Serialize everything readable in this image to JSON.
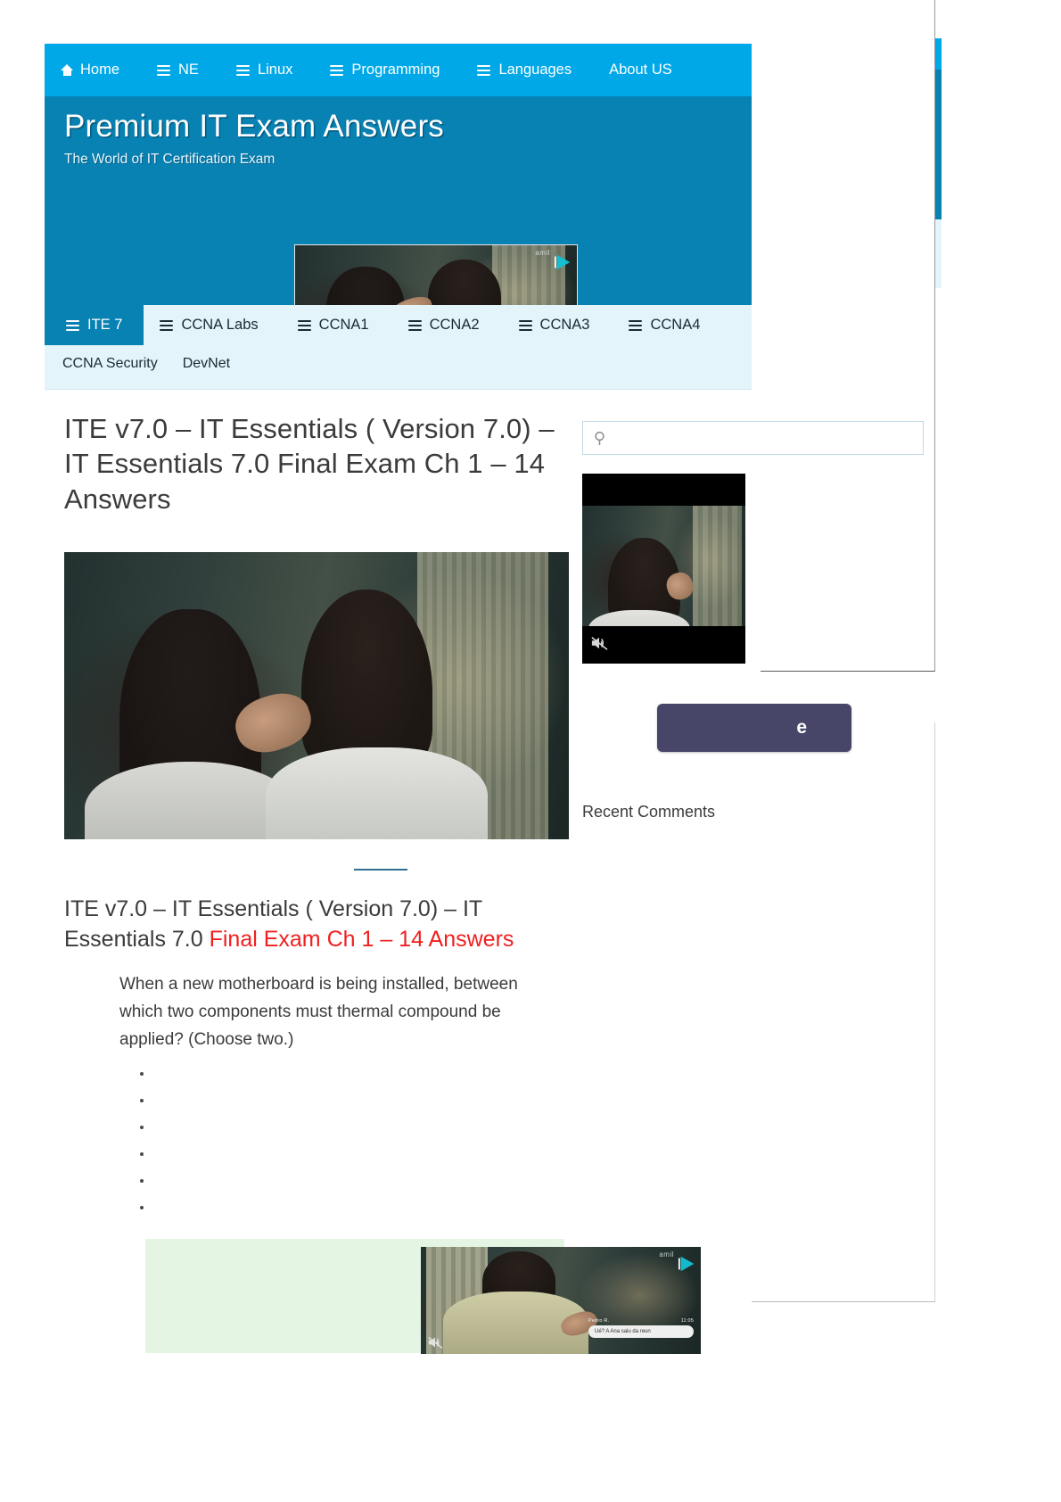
{
  "topnav": {
    "items": [
      {
        "label": "Home",
        "icon": "home-icon",
        "has_menu": false
      },
      {
        "label": "NE",
        "icon": "hamburger-icon",
        "has_menu": true
      },
      {
        "label": "Linux",
        "icon": "hamburger-icon",
        "has_menu": true
      },
      {
        "label": "Programming",
        "icon": "hamburger-icon",
        "has_menu": true
      },
      {
        "label": "Languages",
        "icon": "hamburger-icon",
        "has_menu": true
      },
      {
        "label": "About US",
        "icon": "",
        "has_menu": false
      }
    ]
  },
  "hero": {
    "title": "Premium IT Exam Answers",
    "tagline": "The World of IT Certification Exam",
    "ad_video": {
      "brand_watermark": "amil",
      "muted": true,
      "play_icon": "play-triangle-icon"
    }
  },
  "subnav": {
    "row1": [
      {
        "label": "ITE 7",
        "icon": "hamburger-icon",
        "active": true
      },
      {
        "label": "CCNA Labs",
        "icon": "hamburger-icon",
        "active": false
      },
      {
        "label": "CCNA1",
        "icon": "hamburger-icon",
        "active": false
      },
      {
        "label": "CCNA2",
        "icon": "hamburger-icon",
        "active": false
      },
      {
        "label": "CCNA3",
        "icon": "hamburger-icon",
        "active": false
      },
      {
        "label": "CCNA4",
        "icon": "hamburger-icon",
        "active": false
      }
    ],
    "row2": [
      {
        "label": "CCNA Security",
        "icon": "",
        "active": false
      },
      {
        "label": "DevNet",
        "icon": "",
        "active": false
      }
    ]
  },
  "post": {
    "title": "ITE v7.0 – IT Essentials ( Version 7.0) – IT Essentials 7.0 Final Exam Ch 1 – 14 Answers",
    "heading_plain": "ITE v7.0 – IT Essentials ( Version 7.0) – IT Essentials 7.0 ",
    "heading_red": "Final Exam Ch 1 – 14 Answers",
    "question": "When a new motherboard is being installed, between which two components must thermal compound be applied? (Choose two.)",
    "choices": [
      "",
      "",
      "",
      "",
      "",
      ""
    ]
  },
  "sidebar": {
    "search": {
      "value": "",
      "placeholder": "",
      "icon": "search-icon"
    },
    "video": {
      "muted": true,
      "mute_icon": "mute-icon"
    },
    "subscribe_button_label": "e",
    "recent_comments_heading": "Recent Comments"
  },
  "bottom_ad": {
    "brand_watermark": "amil",
    "play_icon": "play-triangle-icon",
    "mute_icon": "mute-icon",
    "chat": {
      "sender": "Pedro R.",
      "time": "11:05",
      "message": "Ué? A Ana saiu da reun"
    }
  },
  "colors": {
    "topnav_blue": "#00a8e8",
    "hero_blue": "#0881b3",
    "subnav_light": "#e3f4fb",
    "accent_red": "#ef2020",
    "subscribe_purple": "#484668",
    "answer_green": "#e5f5e4",
    "text_dark": "#3b3b3b"
  }
}
